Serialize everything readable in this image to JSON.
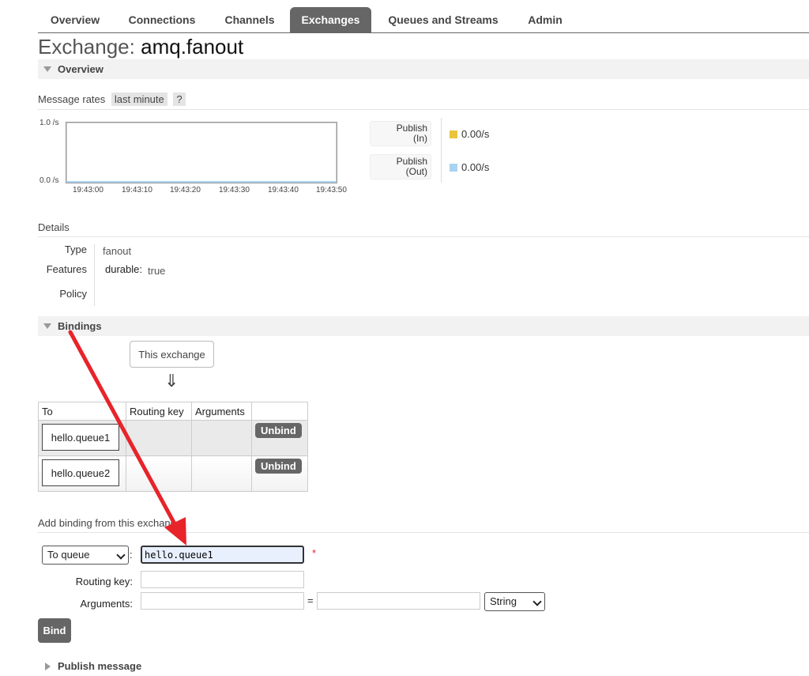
{
  "nav": {
    "tabs": [
      {
        "label": "Overview"
      },
      {
        "label": "Connections"
      },
      {
        "label": "Channels"
      },
      {
        "label": "Exchanges",
        "active": true
      },
      {
        "label": "Queues and Streams"
      },
      {
        "label": "Admin"
      }
    ]
  },
  "page": {
    "title_prefix": "Exchange:",
    "exchange_name": "amq.fanout"
  },
  "overview": {
    "section_label": "Overview",
    "message_rates_label": "Message rates",
    "range_option": "last minute",
    "help": "?",
    "chart": {
      "y_top": "1.0 /s",
      "y_bottom": "0.0 /s",
      "x_ticks": [
        "19:43:00",
        "19:43:10",
        "19:43:20",
        "19:43:30",
        "19:43:40",
        "19:43:50"
      ]
    },
    "legend": [
      {
        "label_line1": "Publish",
        "label_line2": "(In)",
        "value": "0.00/s",
        "color": "#e7c53e"
      },
      {
        "label_line1": "Publish",
        "label_line2": "(Out)",
        "value": "0.00/s",
        "color": "#a9d4f0"
      }
    ]
  },
  "details": {
    "heading": "Details",
    "type_label": "Type",
    "type_value": "fanout",
    "features_label": "Features",
    "features_key": "durable:",
    "features_value": "true",
    "policy_label": "Policy"
  },
  "bindings": {
    "section_label": "Bindings",
    "source_box": "This exchange",
    "arrow": "⇓",
    "columns": [
      "To",
      "Routing key",
      "Arguments",
      ""
    ],
    "rows": [
      {
        "to": "hello.queue1",
        "action": "Unbind"
      },
      {
        "to": "hello.queue2",
        "action": "Unbind"
      }
    ]
  },
  "add_binding": {
    "heading": "Add binding from this exchange",
    "destination_type": "To queue",
    "destination_value": "hello.queue1",
    "required_mark": "*",
    "routing_key_label": "Routing key:",
    "arguments_label": "Arguments:",
    "equals": "=",
    "arg_type": "String",
    "bind_button": "Bind",
    "colon": ":"
  },
  "publish": {
    "section_label": "Publish message"
  },
  "annotation": {
    "color": "#e8232a"
  }
}
